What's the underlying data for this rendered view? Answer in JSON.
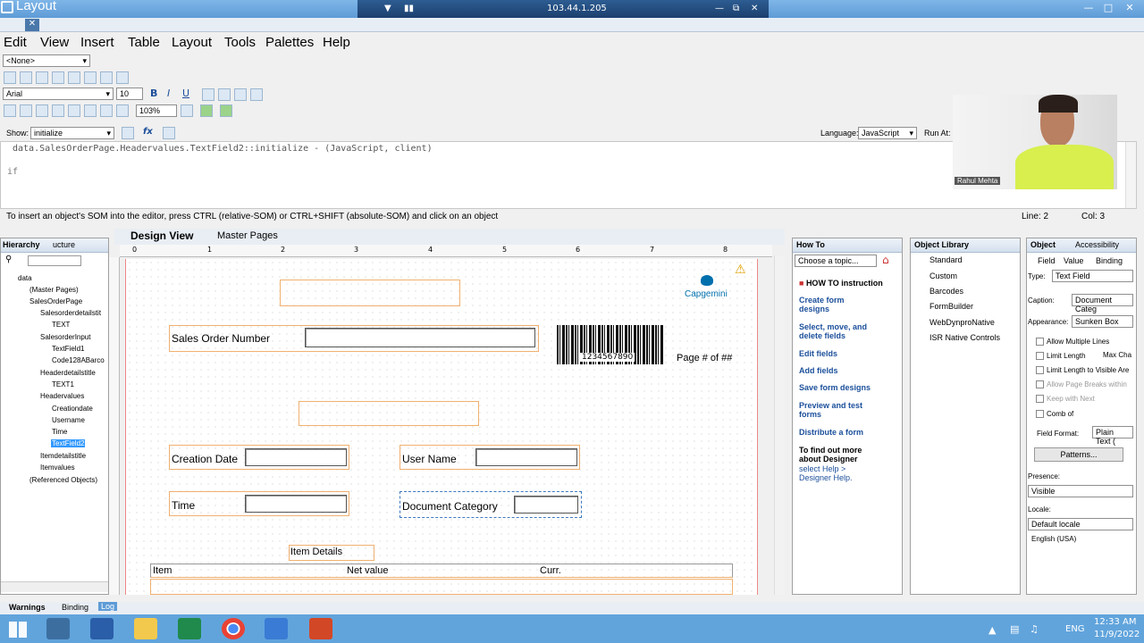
{
  "window": {
    "title": "Layout",
    "remote_ip": "103.44.1.205"
  },
  "menu": [
    "Edit",
    "View",
    "Insert",
    "Table",
    "Layout",
    "Tools",
    "Palettes",
    "Help"
  ],
  "toolbar": {
    "style_select": "<None>",
    "font": "Arial",
    "font_size": "10",
    "zoom": "103%",
    "show_label": "Show:",
    "show_value": "initialize",
    "language_label": "Language:",
    "language_value": "JavaScript",
    "run_at_label": "Run At:"
  },
  "script": {
    "header": "data.SalesOrderPage.Headervalues.TextField2::initialize - (JavaScript, client)",
    "line1": "if"
  },
  "status": {
    "hint": "To insert an object's SOM into the editor, press CTRL (relative-SOM) or CTRL+SHIFT (absolute-SOM) and click on an object",
    "line": "Line: 2",
    "col": "Col: 3"
  },
  "webcam": {
    "name": "Rahul Mehta"
  },
  "hierarchy": {
    "tabs": [
      "Hierarchy",
      "ucture"
    ],
    "items": [
      "data",
      "(Master Pages)",
      "SalesOrderPage",
      "Salesorderdetailstit",
      "TEXT",
      "SalesorderInput",
      "TextField1",
      "Code128ABarco",
      "Headerdetailstitle",
      "TEXT1",
      "Headervalues",
      "Creationdate",
      "Username",
      "Time",
      "TextField2",
      "Itemdetailstitle",
      "Itemvalues",
      "(Referenced Objects)"
    ]
  },
  "design": {
    "tabs": [
      "Design View",
      "Master Pages"
    ],
    "sales_order_label": "Sales Order Number",
    "barcode_text": "1234567890",
    "logo": "Capgemini",
    "page_label": "Page # of ##",
    "creation_date": "Creation Date",
    "user_name": "User Name",
    "time": "Time",
    "document_category": "Document Category",
    "item_details": "Item Details",
    "columns": [
      "Item",
      "Net value",
      "Curr."
    ],
    "ruler": [
      "0",
      "1",
      "2",
      "3",
      "4",
      "5",
      "6",
      "7",
      "8"
    ]
  },
  "howto": {
    "title": "How To",
    "topic": "Choose a topic...",
    "heading": "HOW TO instruction",
    "links": [
      "Create form designs",
      "Select, move, and delete fields",
      "Edit fields",
      "Add fields",
      "Save form designs",
      "Preview and test forms",
      "Distribute a form"
    ],
    "more_bold": "To find out more about Designer",
    "more": "select Help > Designer Help."
  },
  "library": {
    "title": "Object Library",
    "items": [
      "Standard",
      "Custom",
      "Barcodes",
      "FormBuilder",
      "WebDynproNative",
      "ISR Native Controls"
    ]
  },
  "object": {
    "tabs": [
      "Object",
      "Accessibility"
    ],
    "subtabs": [
      "Field",
      "Value",
      "Binding"
    ],
    "type_label": "Type:",
    "type_value": "Text Field",
    "caption_label": "Caption:",
    "caption_value": "Document Categ",
    "appearance_label": "Appearance:",
    "appearance_value": "Sunken Box",
    "checks": [
      "Allow Multiple Lines",
      "Limit Length",
      "Limit Length to Visible Are",
      "Allow Page Breaks within",
      "Keep with Next",
      "Comb of"
    ],
    "max_chars": "Max Cha",
    "field_format_label": "Field Format:",
    "field_format_value": "Plain Text (",
    "patterns": "Patterns...",
    "presence_label": "Presence:",
    "presence_value": "Visible",
    "locale_label": "Locale:",
    "locale_value": "Default locale",
    "locale_note": "English (USA)"
  },
  "bottom_tabs": [
    "Warnings",
    "Binding",
    "Log"
  ],
  "tray": {
    "lang": "ENG",
    "time": "12:33 AM",
    "date": "11/9/2022"
  },
  "colors": {
    "accent": "#5e9bd6",
    "taskbar": "#61a4dc",
    "field_orange": "#f0b070",
    "selection": "#3399ff"
  }
}
